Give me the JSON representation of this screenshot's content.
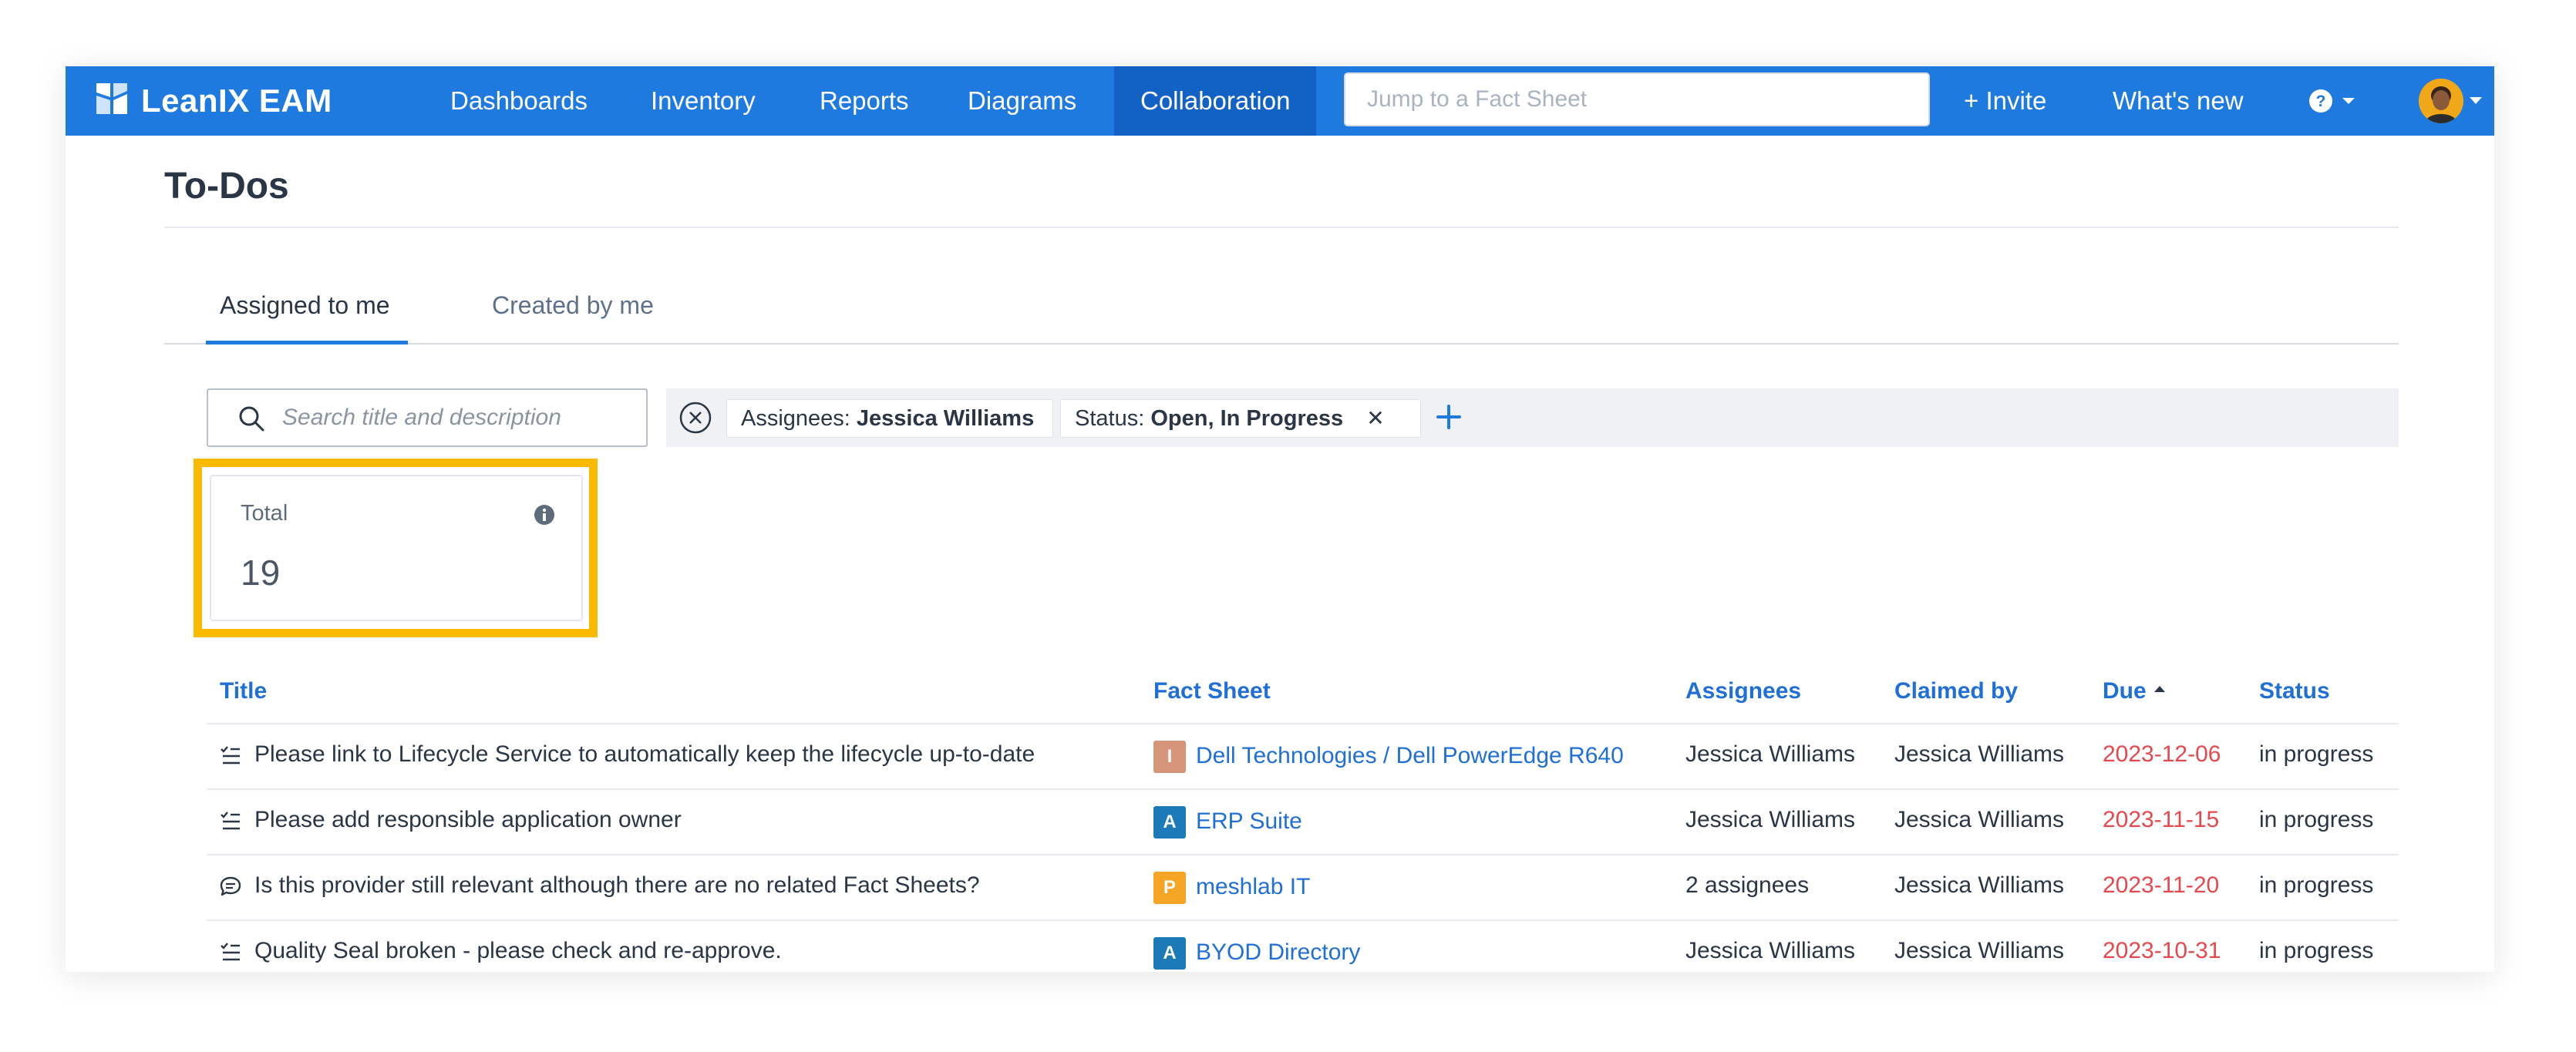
{
  "topbar": {
    "brand": "LeanIX EAM",
    "nav": [
      "Dashboards",
      "Inventory",
      "Reports",
      "Diagrams",
      "Collaboration"
    ],
    "active_nav": "Collaboration",
    "jump_placeholder": "Jump to a Fact Sheet",
    "invite_label": "+ Invite",
    "whats_new_label": "What's new",
    "accent": "#1f7ae0"
  },
  "page": {
    "title": "To-Dos",
    "tabs": [
      "Assigned to me",
      "Created by me"
    ],
    "active_tab": "Assigned to me"
  },
  "filters": {
    "search_placeholder": "Search title and description",
    "chips": [
      {
        "key": "Assignees:",
        "value": "Jessica Williams"
      },
      {
        "key": "Status:",
        "value": "Open,  In Progress"
      }
    ]
  },
  "summary": {
    "label": "Total",
    "value": "19",
    "highlight_color": "#fbb900"
  },
  "table": {
    "columns": [
      "Title",
      "Fact Sheet",
      "Assignees",
      "Claimed by",
      "Due",
      "Status"
    ],
    "sort_column": "Due",
    "rows": [
      {
        "icon": "checklist-icon",
        "title": "Please link to Lifecycle Service to automatically keep the lifecycle up-to-date",
        "fs_letter": "I",
        "fs_color": "#d4957a",
        "fact_sheet": "Dell Technologies / Dell PowerEdge R640",
        "assignees": "Jessica Williams",
        "claimed_by": "Jessica Williams",
        "due": "2023-12-06",
        "status": "in progress"
      },
      {
        "icon": "checklist-icon",
        "title": "Please add responsible application owner",
        "fs_letter": "A",
        "fs_color": "#1c7ab8",
        "fact_sheet": "ERP Suite",
        "assignees": "Jessica Williams",
        "claimed_by": "Jessica Williams",
        "due": "2023-11-15",
        "status": "in progress"
      },
      {
        "icon": "comment-icon",
        "title": "Is this provider still relevant although there are no related Fact Sheets?",
        "fs_letter": "P",
        "fs_color": "#f5a524",
        "fact_sheet": "meshlab IT",
        "assignees": "2 assignees",
        "claimed_by": "Jessica Williams",
        "due": "2023-11-20",
        "status": "in progress"
      },
      {
        "icon": "checklist-icon",
        "title": "Quality Seal broken - please check and re-approve.",
        "fs_letter": "A",
        "fs_color": "#1c7ab8",
        "fact_sheet": "BYOD Directory",
        "assignees": "Jessica Williams",
        "claimed_by": "Jessica Williams",
        "due": "2023-10-31",
        "status": "in progress"
      }
    ]
  }
}
